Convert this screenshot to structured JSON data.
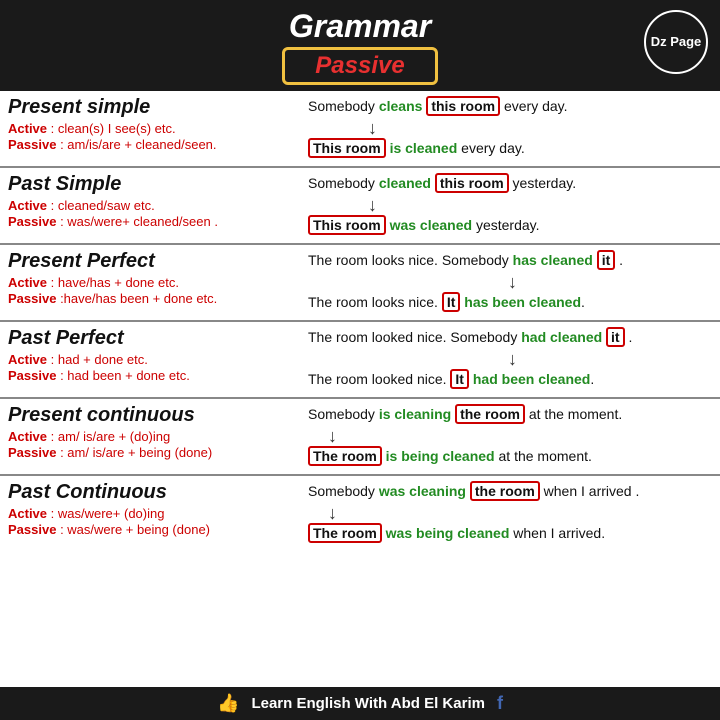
{
  "header": {
    "title": "Grammar",
    "passive": "Passive",
    "dz_page": "Dz Page"
  },
  "sections": [
    {
      "id": "present-simple",
      "title": "Present simple",
      "active_label": "Active",
      "active_text": ": clean(s) I see(s) etc.",
      "passive_label": "Passive",
      "passive_text": ": am/is/are + cleaned/seen.",
      "example1": "Somebody",
      "example1_green": "cleans",
      "example1_box": "this room",
      "example1_end": "every day.",
      "example2_box": "This room",
      "example2_green": "is cleaned",
      "example2_end": "every day."
    },
    {
      "id": "past-simple",
      "title": "Past Simple",
      "active_label": "Active",
      "active_text": ": cleaned/saw etc.",
      "passive_label": "Passive",
      "passive_text": ": was/were+ cleaned/seen .",
      "example1": "Somebody",
      "example1_green": "cleaned",
      "example1_box": "this room",
      "example1_end": "yesterday.",
      "example2_box": "This room",
      "example2_green": "was cleaned",
      "example2_end": "yesterday."
    },
    {
      "id": "present-perfect",
      "title": "Present Perfect",
      "active_label": "Active",
      "active_text": ": have/has + done etc.",
      "passive_label": "Passive",
      "passive_text": ": have/has been + done etc.",
      "example1": "The room looks nice. Somebody",
      "example1_green": "has cleaned",
      "example1_box": "it",
      "example1_end": ".",
      "example2_pre": "The room looks nice.",
      "example2_box": "It",
      "example2_green": "has been cleaned",
      "example2_end": "."
    },
    {
      "id": "past-perfect",
      "title": "Past Perfect",
      "active_label": "Active",
      "active_text": ": had + done etc.",
      "passive_label": "Passive",
      "passive_text": ": had been + done etc.",
      "example1": "The room looked nice. Somebody",
      "example1_green": "had cleaned",
      "example1_box": "it",
      "example1_end": ".",
      "example2_pre": "The room looked nice.",
      "example2_box": "It",
      "example2_green": "had been cleaned",
      "example2_end": "."
    },
    {
      "id": "present-continuous",
      "title": "Present continuous",
      "active_label": "Active",
      "active_text": ": am/ is/are + (do)ing",
      "passive_label": "Passive",
      "passive_text": ": am/ is/are + being (done)",
      "example1": "Somebody",
      "example1_green": "is cleaning",
      "example1_box": "the room",
      "example1_end": "at the moment.",
      "example2_box": "The room",
      "example2_green": "is being cleaned",
      "example2_end": "at the moment."
    },
    {
      "id": "past-continuous",
      "title": "Past Continuous",
      "active_label": "Active",
      "active_text": ": was/were+ (do)ing",
      "passive_label": "Passive",
      "passive_text": ": was/were + being (done)",
      "example1": "Somebody",
      "example1_green": "was cleaning",
      "example1_box": "the room",
      "example1_end": "when I arrived .",
      "example2_box": "The room",
      "example2_green": "was being cleaned",
      "example2_end": "when I arrived."
    }
  ],
  "footer": {
    "text": "Learn English With Abd El Karim"
  }
}
